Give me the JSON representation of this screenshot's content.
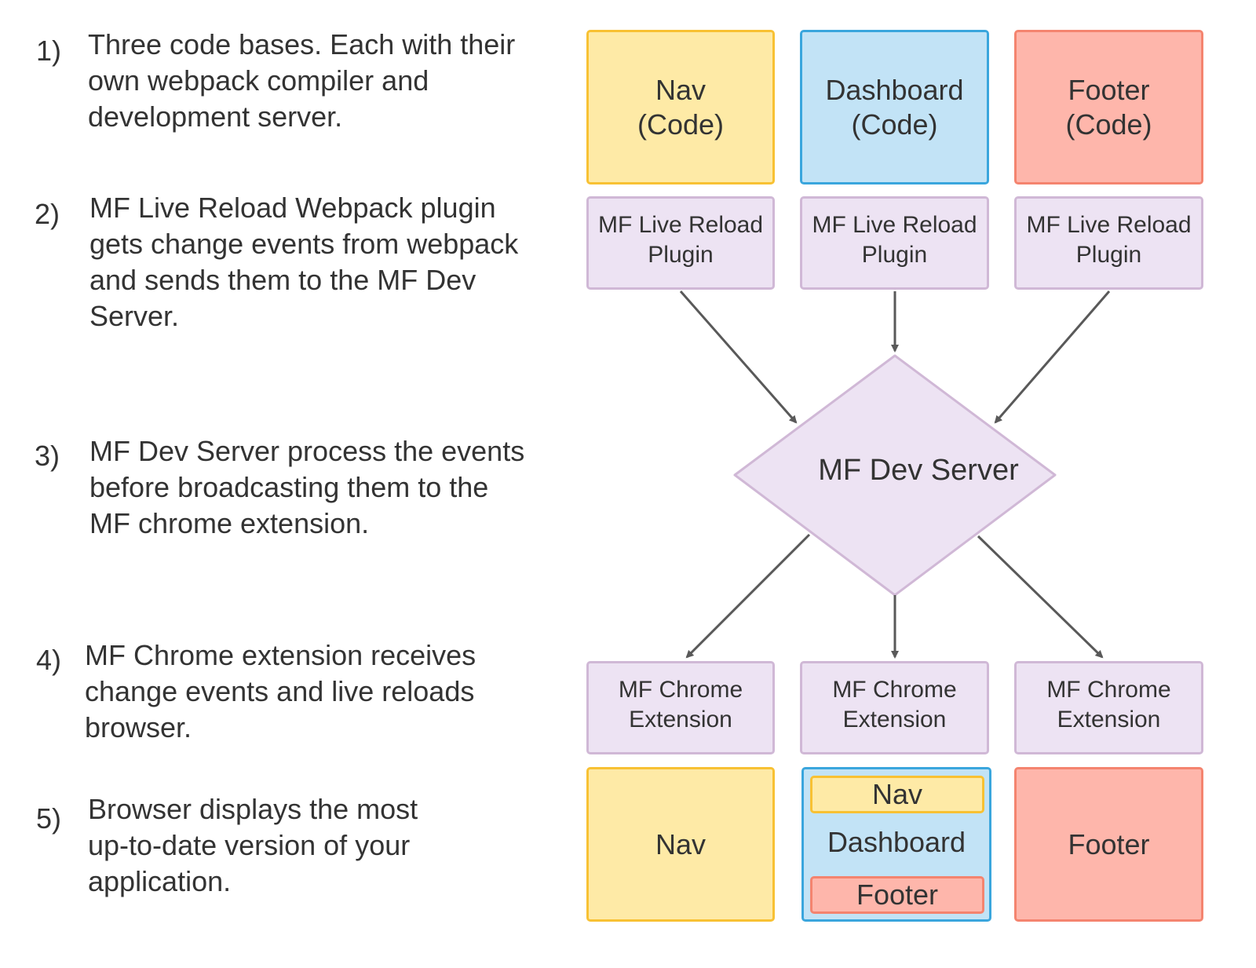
{
  "steps": [
    {
      "num": "1)",
      "text": "Three code bases. Each with their\nown webpack compiler and\ndevelopment server."
    },
    {
      "num": "2)",
      "text": "MF Live Reload Webpack plugin\ngets change events from webpack\nand sends them to the MF Dev\nServer."
    },
    {
      "num": "3)",
      "text": "MF Dev Server process the events\nbefore broadcasting them to the\nMF chrome extension."
    },
    {
      "num": "4)",
      "text": "MF Chrome extension receives\nchange events and live reloads\nbrowser."
    },
    {
      "num": "5)",
      "text": "Browser displays the most\nup-to-date version of your\napplication."
    }
  ],
  "code_boxes": [
    {
      "label": "Nav\n(Code)"
    },
    {
      "label": "Dashboard\n(Code)"
    },
    {
      "label": "Footer\n(Code)"
    }
  ],
  "plugin_boxes": [
    {
      "label": "MF Live Reload\nPlugin"
    },
    {
      "label": "MF Live Reload\nPlugin"
    },
    {
      "label": "MF Live Reload\nPlugin"
    }
  ],
  "server": {
    "label": "MF Dev Server"
  },
  "extension_boxes": [
    {
      "label": "MF Chrome\nExtension"
    },
    {
      "label": "MF Chrome\nExtension"
    },
    {
      "label": "MF Chrome\nExtension"
    }
  ],
  "output_boxes": {
    "nav": "Nav",
    "dashboard": {
      "label": "Dashboard",
      "inner_top": "Nav",
      "inner_bottom": "Footer"
    },
    "footer": "Footer"
  },
  "colors": {
    "nav_fill": "#feeaa6",
    "nav_border": "#f8c133",
    "dashboard_fill": "#c2e3f6",
    "dashboard_border": "#3aa6dd",
    "footer_fill": "#feb6ab",
    "footer_border": "#f4846f",
    "process_fill": "#ede3f3",
    "process_border": "#d0b8d6",
    "arrow": "#595959",
    "text": "#333333"
  }
}
